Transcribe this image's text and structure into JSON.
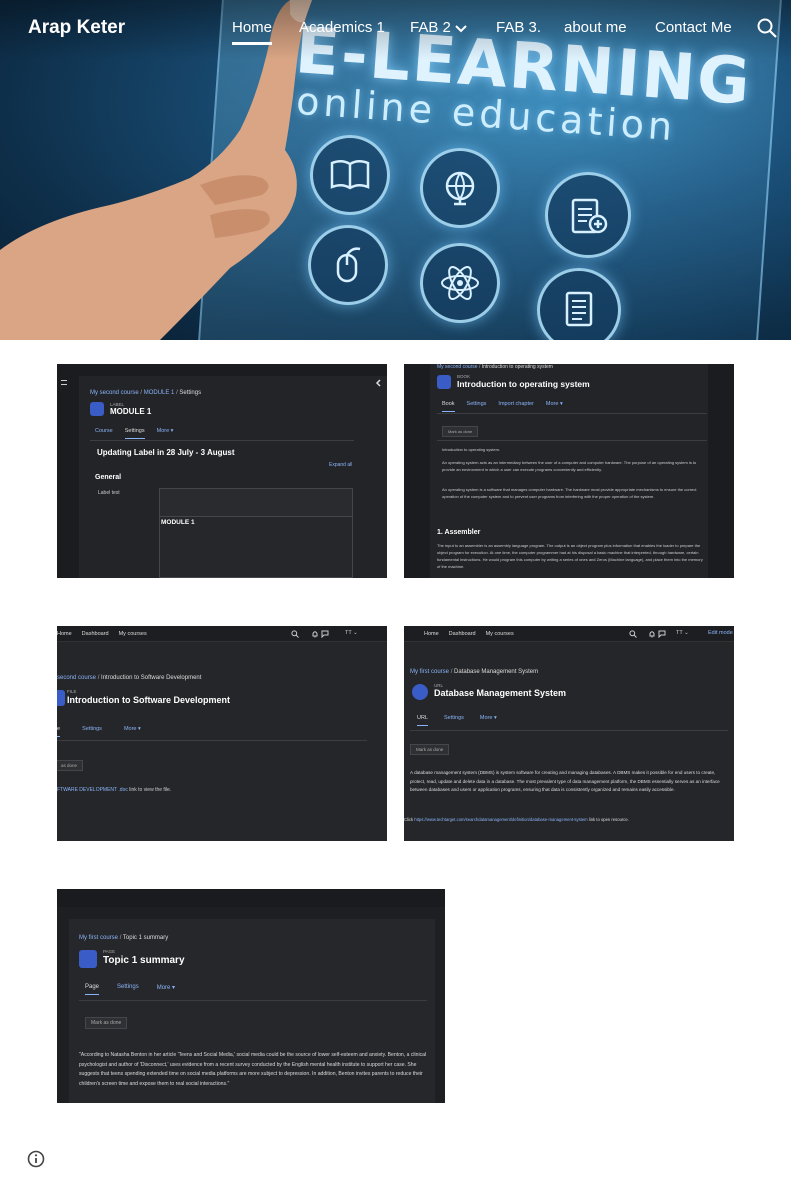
{
  "site": {
    "title": "Arap Keter",
    "nav": [
      {
        "label": "Home"
      },
      {
        "label": "Academics 1"
      },
      {
        "label": "FAB 2"
      },
      {
        "label": "FAB 3."
      },
      {
        "label": "about me"
      },
      {
        "label": "Contact Me"
      }
    ]
  },
  "hero": {
    "headline": "E-LEARNING",
    "subline": "online education",
    "icons": [
      "book-icon",
      "globe-icon",
      "clipboard-icon",
      "mouse-icon",
      "atom-icon",
      "document-icon"
    ]
  },
  "tiles": {
    "module1": {
      "crumb": [
        "My second course",
        "MODULE 1",
        "Settings"
      ],
      "kind": "LABEL",
      "heading": "MODULE 1",
      "tabs": [
        "Course",
        "Settings",
        "More ▾"
      ],
      "subheading": "Updating Label in 28 July - 3 August",
      "expand": "Expand all",
      "section": "General",
      "field_label": "Label text",
      "editor_text": "MODULE 1"
    },
    "os": {
      "crumb": [
        "My second course",
        "Introduction to operating system"
      ],
      "kind": "BOOK",
      "heading": "Introduction to operating system",
      "tabs": [
        "Book",
        "Settings",
        "Import chapter",
        "More ▾"
      ],
      "mark": "Mark as done",
      "intro_title": "Introduction to operating system.",
      "p1": "An operating system acts as an intermediary between the user of a computer and computer hardware. The purpose of an operating system is to provide an environment in which a user can execute programs conveniently and efficiently.",
      "p2": "An operating system is a software that manages computer hardware. The hardware must provide appropriate mechanisms to ensure the correct operation of the computer system and to prevent user programs from interfering with the proper operation of the system.",
      "section": "1. Assembler",
      "p3": "The input to an assembler is an assembly language program. The output is an object program plus information that enables the loader to prepare the object program for execution. At one time, the computer programmer had at his disposal a basic machine that interpreted, through hardware, certain fundamental instructions. He would program this computer by writing a series of ones and Zeros (Machine language), and place them into the memory of the machine."
    },
    "software": {
      "topnav": [
        "Home",
        "Dashboard",
        "My courses"
      ],
      "crumb": [
        "second course",
        "Introduction to Software Development"
      ],
      "kind": "FILE",
      "heading": "Introduction to Software Development",
      "tabs": [
        "e",
        "Settings",
        "More ▾"
      ],
      "mark": "as done",
      "file_text_link": "FTWARE DEVELOPMENT .doc",
      "file_text_rest": " link to view the file."
    },
    "dbms": {
      "topnav": [
        "Home",
        "Dashboard",
        "My courses"
      ],
      "edit_mode": "Edit mode",
      "crumb": [
        "My first course",
        "Database Management System"
      ],
      "kind": "URL",
      "heading": "Database Management System",
      "tabs": [
        "URL",
        "Settings",
        "More ▾"
      ],
      "mark": "Mark as done",
      "body": "A database management system (DBMS) is system software for creating and managing databases. A DBMS makes it possible for end users to create, protect, read, update and delete data in a database. The most prevalent type of data management platform, the DBMS essentially serves as an interface between databases and users or application programs, ensuring that data is consistently organized and remains easily accessible.",
      "click_prefix": "Click ",
      "link": "https://www.techtarget.com/searchdatamanagement/definition/database-management-system",
      "click_suffix": " link to open resource."
    },
    "topic1": {
      "crumb": [
        "My first course",
        "Topic 1 summary"
      ],
      "kind": "PAGE",
      "heading": "Topic 1 summary",
      "tabs": [
        "Page",
        "Settings",
        "More ▾"
      ],
      "mark": "Mark as done",
      "body": "\"According to Natasha Benton in her article 'Teens and Social Media,' social media could be the source of lower self-esteem and anxiety. Benton, a clinical psychologist and author of 'Disconnect,' uses evidence from a recent survey conducted by the English mental health institute to support her case. She suggests that teens spending extended time on social media platforms are more subject to depression. In addition, Benton invites parents to reduce their children's screen time and expose them to real social interactions.\""
    }
  }
}
